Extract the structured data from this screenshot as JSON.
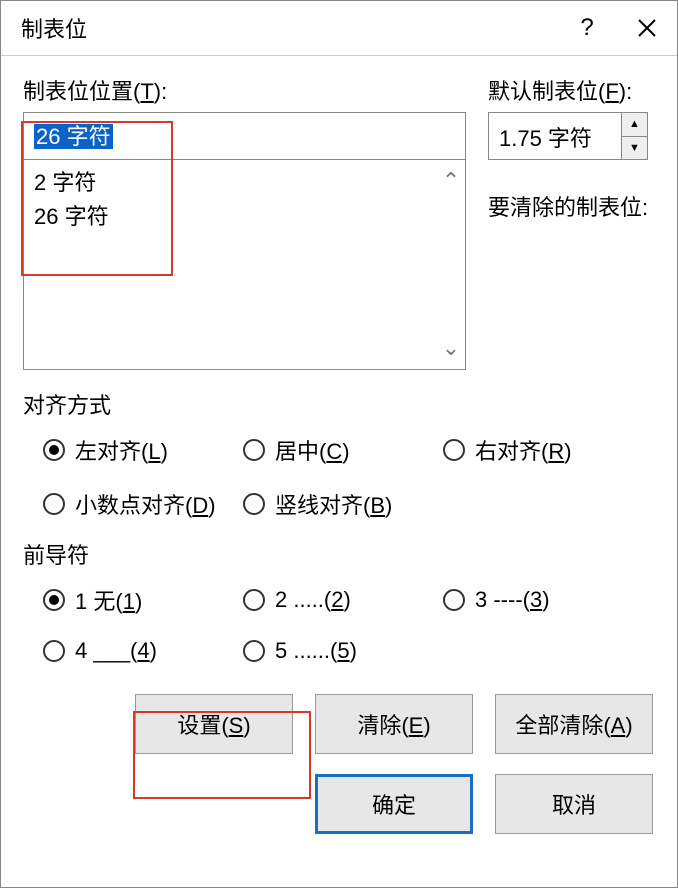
{
  "title": "制表位",
  "help": "?",
  "close": "×",
  "labels": {
    "tabPosition": "制表位位置(T):",
    "defaultTab": "默认制表位(F):",
    "toClear": "要清除的制表位:",
    "alignment": "对齐方式",
    "leader": "前导符"
  },
  "tabInputValue": "26 字符",
  "tabList": [
    "2 字符",
    "26 字符"
  ],
  "defaultTabValue": "1.75 字符",
  "alignmentOptions": {
    "left": {
      "label": "左对齐(L)",
      "checked": true
    },
    "center": {
      "label": "居中(C)",
      "checked": false
    },
    "right": {
      "label": "右对齐(R)",
      "checked": false
    },
    "decimal": {
      "label": "小数点对齐(D)",
      "checked": false
    },
    "bar": {
      "label": "竖线对齐(B)",
      "checked": false
    }
  },
  "leaderOptions": {
    "l1": {
      "label": "1 无(1)",
      "checked": true
    },
    "l2": {
      "label": "2 .....(2)",
      "checked": false
    },
    "l3": {
      "label": "3 ----(3)",
      "checked": false
    },
    "l4": {
      "label": "4 ___(4)",
      "checked": false
    },
    "l5": {
      "label": "5 ......(5)",
      "checked": false
    }
  },
  "buttons": {
    "set": "设置(S)",
    "clear": "清除(E)",
    "clearAll": "全部清除(A)",
    "ok": "确定",
    "cancel": "取消"
  }
}
